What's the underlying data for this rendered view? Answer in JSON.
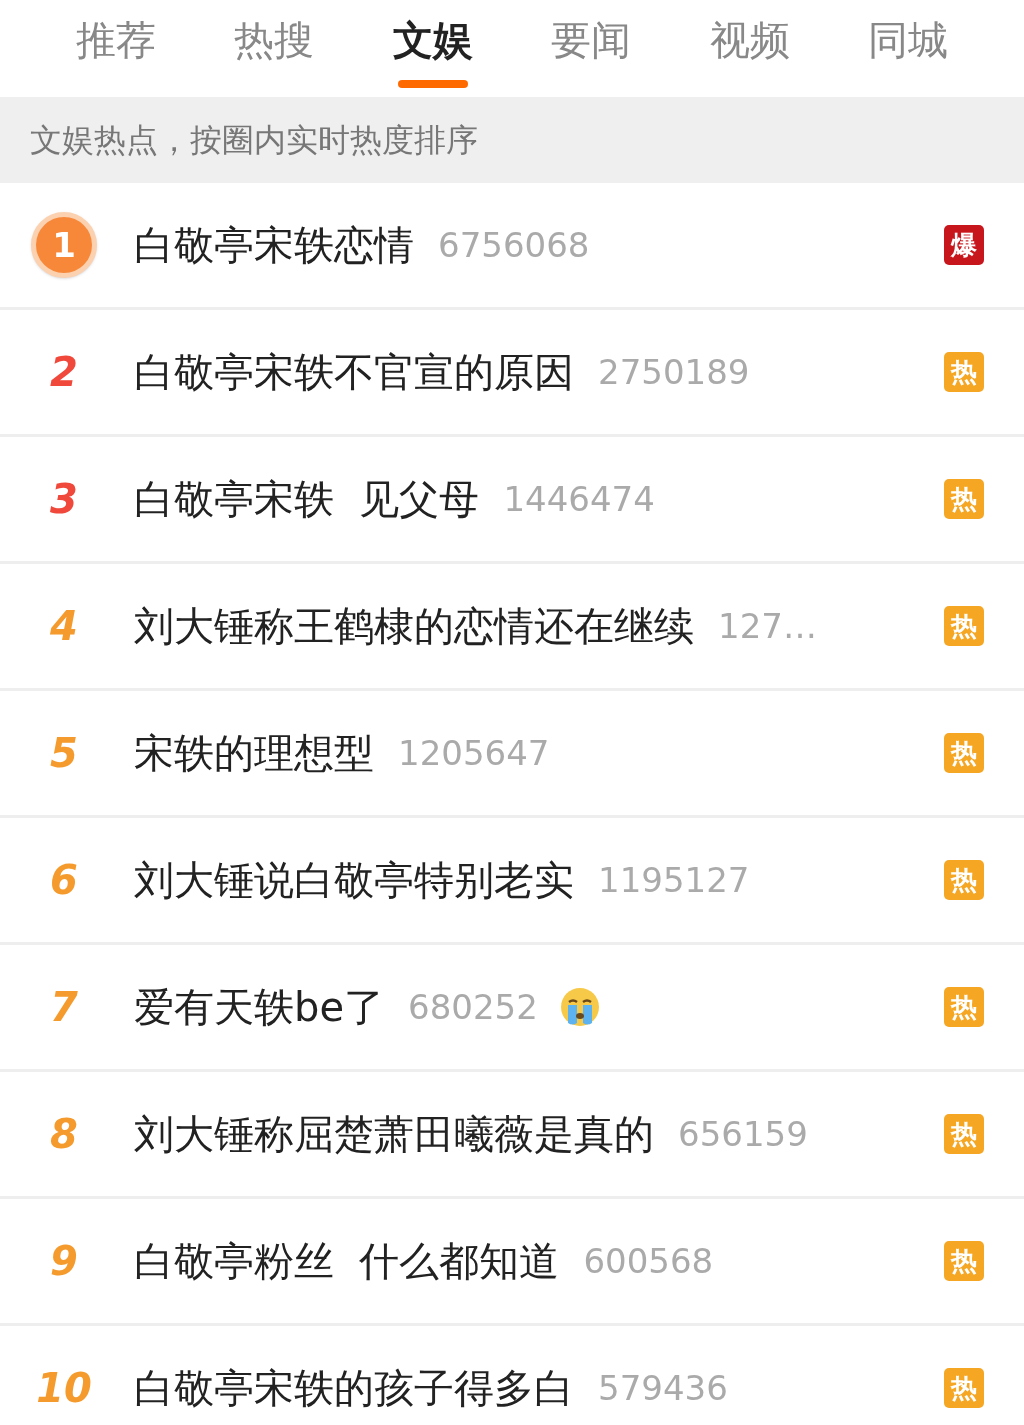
{
  "tabs": [
    {
      "label": "推荐",
      "selected": false
    },
    {
      "label": "热搜",
      "selected": false
    },
    {
      "label": "文娱",
      "selected": true
    },
    {
      "label": "要闻",
      "selected": false
    },
    {
      "label": "视频",
      "selected": false
    },
    {
      "label": "同城",
      "selected": false
    }
  ],
  "subtitle": "文娱热点，按圈内实时热度排序",
  "rows": [
    {
      "rank": {
        "text": "1",
        "kind": "medal"
      },
      "title": "白敬亭宋轶恋情",
      "count": "6756068",
      "badge": {
        "text": "爆",
        "kind": "explosive"
      },
      "emoji": false
    },
    {
      "rank": {
        "text": "2",
        "kind": "plain",
        "color": "#f0483a"
      },
      "title": "白敬亭宋轶不官宣的原因",
      "count": "2750189",
      "badge": {
        "text": "热",
        "kind": "hot"
      },
      "emoji": false
    },
    {
      "rank": {
        "text": "3",
        "kind": "plain",
        "color": "#f0483a"
      },
      "title": "白敬亭宋轶  见父母",
      "count": "1446474",
      "badge": {
        "text": "热",
        "kind": "hot"
      },
      "emoji": false
    },
    {
      "rank": {
        "text": "4",
        "kind": "plain",
        "color": "#f59b2d"
      },
      "title": "刘大锤称王鹤棣的恋情还在继续",
      "count": "127…",
      "badge": {
        "text": "热",
        "kind": "hot"
      },
      "emoji": false
    },
    {
      "rank": {
        "text": "5",
        "kind": "plain",
        "color": "#f59b2d"
      },
      "title": "宋轶的理想型",
      "count": "1205647",
      "badge": {
        "text": "热",
        "kind": "hot"
      },
      "emoji": false
    },
    {
      "rank": {
        "text": "6",
        "kind": "plain",
        "color": "#f59b2d"
      },
      "title": "刘大锤说白敬亭特别老实",
      "count": "1195127",
      "badge": {
        "text": "热",
        "kind": "hot"
      },
      "emoji": false
    },
    {
      "rank": {
        "text": "7",
        "kind": "plain",
        "color": "#f59b2d"
      },
      "title": "爱有天轶be了",
      "count": "680252",
      "badge": {
        "text": "热",
        "kind": "hot"
      },
      "emoji": true
    },
    {
      "rank": {
        "text": "8",
        "kind": "plain",
        "color": "#f59b2d"
      },
      "title": "刘大锤称屈楚萧田曦薇是真的",
      "count": "656159",
      "badge": {
        "text": "热",
        "kind": "hot"
      },
      "emoji": false
    },
    {
      "rank": {
        "text": "9",
        "kind": "plain",
        "color": "#f59b2d"
      },
      "title": "白敬亭粉丝  什么都知道",
      "count": "600568",
      "badge": {
        "text": "热",
        "kind": "hot"
      },
      "emoji": false
    },
    {
      "rank": {
        "text": "10",
        "kind": "plain",
        "color": "#f59b2d"
      },
      "title": "白敬亭宋轶的孩子得多白",
      "count": "579436",
      "badge": {
        "text": "热",
        "kind": "hot"
      },
      "emoji": false
    }
  ]
}
